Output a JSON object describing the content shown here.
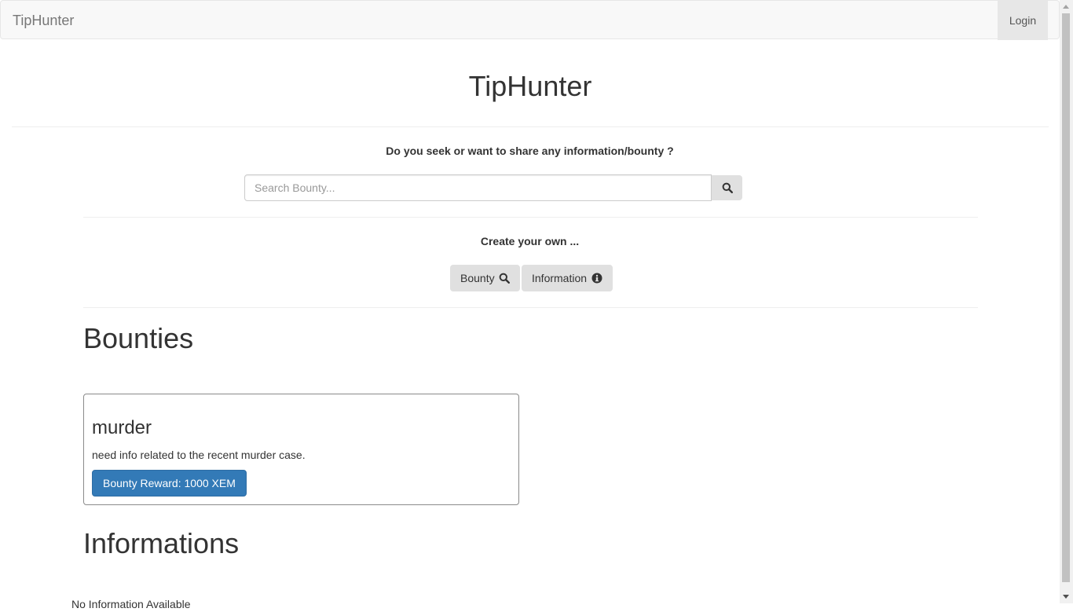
{
  "navbar": {
    "brand": "TipHunter",
    "login": "Login"
  },
  "header": {
    "title": "TipHunter"
  },
  "search": {
    "prompt": "Do you seek or want to share any information/bounty ?",
    "placeholder": "Search Bounty..."
  },
  "create": {
    "title": "Create your own ...",
    "bounty_label": "Bounty",
    "information_label": "Information"
  },
  "bounties": {
    "title": "Bounties",
    "items": [
      {
        "title": "murder",
        "description": "need info related to the recent murder case.",
        "reward": "Bounty Reward: 1000 XEM"
      }
    ]
  },
  "informations": {
    "title": "Informations",
    "empty_text": "No Information Available"
  },
  "colors": {
    "primary": "#337ab7",
    "navbar_bg": "#f8f8f8",
    "button_gray": "#e0e0e0"
  }
}
